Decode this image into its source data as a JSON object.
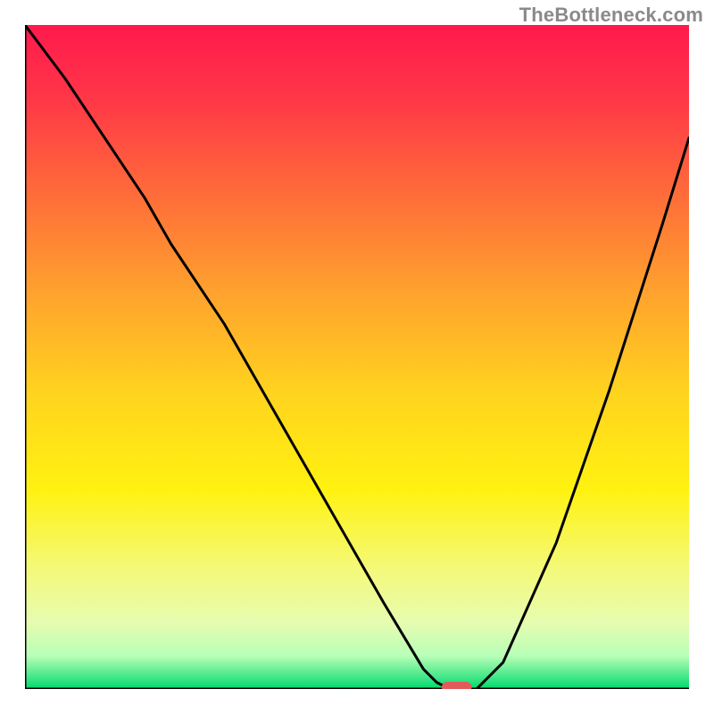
{
  "watermark": "TheBottleneck.com",
  "chart_data": {
    "type": "line",
    "title": "",
    "xlabel": "",
    "ylabel": "",
    "xlim": [
      0,
      100
    ],
    "ylim": [
      0,
      100
    ],
    "grid": false,
    "legend": null,
    "background": {
      "type": "vertical-gradient",
      "stops": [
        {
          "pos": 0.0,
          "color": "#ff1a4d"
        },
        {
          "pos": 0.1,
          "color": "#ff3348"
        },
        {
          "pos": 0.25,
          "color": "#ff6a3a"
        },
        {
          "pos": 0.4,
          "color": "#ffa12e"
        },
        {
          "pos": 0.55,
          "color": "#ffd21f"
        },
        {
          "pos": 0.7,
          "color": "#fff210"
        },
        {
          "pos": 0.82,
          "color": "#f4f97a"
        },
        {
          "pos": 0.9,
          "color": "#e6fcb0"
        },
        {
          "pos": 0.95,
          "color": "#b8ffb8"
        },
        {
          "pos": 1.0,
          "color": "#00d96c"
        }
      ]
    },
    "series": [
      {
        "name": "bottleneck-curve",
        "color": "#000000",
        "x": [
          0,
          6,
          12,
          18,
          22,
          30,
          38,
          46,
          54,
          60,
          62,
          64,
          66,
          68,
          72,
          80,
          88,
          96,
          100
        ],
        "y": [
          100,
          92,
          83,
          74,
          67,
          55,
          41,
          27,
          13,
          3,
          1,
          0,
          0,
          0,
          4,
          22,
          45,
          70,
          83
        ]
      }
    ],
    "marker": {
      "name": "optimal-point",
      "shape": "pill",
      "x": 65,
      "y": 0,
      "width_pct": 4.5,
      "height_pct": 1.6,
      "color": "#e35a5a"
    }
  }
}
